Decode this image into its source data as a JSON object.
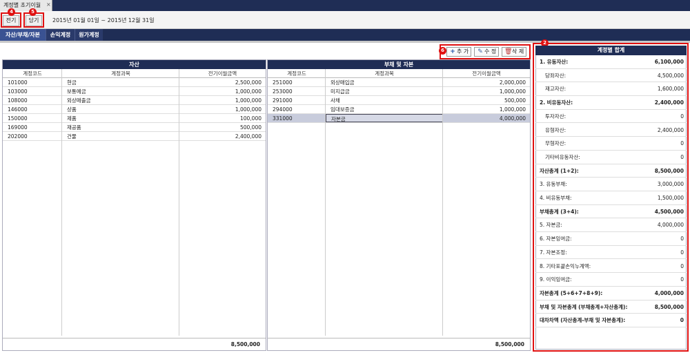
{
  "window_tab": {
    "title": "계정별 초기이월",
    "close": "×"
  },
  "toolbar": {
    "prev_label": "전기",
    "current_label": "당기",
    "period": "2015년 01월 01일 ~ 2015년 12월 31일",
    "badges": {
      "prev": "4",
      "current": "5",
      "actions": "6",
      "summary": "2"
    }
  },
  "subtabs": [
    "자산/부채/자본",
    "손익계정",
    "원가계정"
  ],
  "actions": {
    "add": "추 가",
    "edit": "수 정",
    "delete": "삭 제"
  },
  "assets": {
    "title": "자산",
    "headers": [
      "계정코드",
      "계정과목",
      "전기이월금액"
    ],
    "rows": [
      [
        "101000",
        "현금",
        "2,500,000"
      ],
      [
        "103000",
        "보통예금",
        "1,000,000"
      ],
      [
        "108000",
        "외상매출금",
        "1,000,000"
      ],
      [
        "146000",
        "상품",
        "1,000,000"
      ],
      [
        "150000",
        "제품",
        "100,000"
      ],
      [
        "169000",
        "재공품",
        "500,000"
      ],
      [
        "202000",
        "건물",
        "2,400,000"
      ]
    ],
    "total": "8,500,000"
  },
  "liabilities": {
    "title": "부채 및 자본",
    "headers": [
      "계정코드",
      "계정과목",
      "전기이월금액"
    ],
    "rows": [
      [
        "251000",
        "외상매입금",
        "2,000,000"
      ],
      [
        "253000",
        "미지급금",
        "1,000,000"
      ],
      [
        "291000",
        "사채",
        "500,000"
      ],
      [
        "294000",
        "임대보증금",
        "1,000,000"
      ],
      [
        "331000",
        "자본금",
        "4,000,000"
      ]
    ],
    "selected_row": 4,
    "total": "8,500,000"
  },
  "summary": {
    "title": "계정별 합계",
    "rows": [
      {
        "label": "1. 유동자산:",
        "value": "6,100,000",
        "bold": true,
        "indent": false
      },
      {
        "label": "당좌자산:",
        "value": "4,500,000",
        "bold": false,
        "indent": true
      },
      {
        "label": "재고자산:",
        "value": "1,600,000",
        "bold": false,
        "indent": true
      },
      {
        "label": "2. 비유동자산:",
        "value": "2,400,000",
        "bold": true,
        "indent": false
      },
      {
        "label": "투자자산:",
        "value": "0",
        "bold": false,
        "indent": true
      },
      {
        "label": "유형자산:",
        "value": "2,400,000",
        "bold": false,
        "indent": true
      },
      {
        "label": "무형자산:",
        "value": "0",
        "bold": false,
        "indent": true
      },
      {
        "label": "기타비유동자산:",
        "value": "0",
        "bold": false,
        "indent": true
      },
      {
        "label": "자산총계 (1+2):",
        "value": "8,500,000",
        "bold": true,
        "indent": false
      },
      {
        "label": "3. 유동부채:",
        "value": "3,000,000",
        "bold": false,
        "indent": false
      },
      {
        "label": "4. 비유동부채:",
        "value": "1,500,000",
        "bold": false,
        "indent": false
      },
      {
        "label": "부채총계 (3+4):",
        "value": "4,500,000",
        "bold": true,
        "indent": false
      },
      {
        "label": "5. 자본금:",
        "value": "4,000,000",
        "bold": false,
        "indent": false
      },
      {
        "label": "6. 자본잉여금:",
        "value": "0",
        "bold": false,
        "indent": false
      },
      {
        "label": "7. 자본조정:",
        "value": "0",
        "bold": false,
        "indent": false
      },
      {
        "label": "8. 기타포괄손익누계액:",
        "value": "0",
        "bold": false,
        "indent": false
      },
      {
        "label": "9. 이익잉여금:",
        "value": "0",
        "bold": false,
        "indent": false
      },
      {
        "label": "자본총계 (5+6+7+8+9):",
        "value": "4,000,000",
        "bold": true,
        "indent": false
      },
      {
        "label": "부채 및 자본총계 (부채총계+자산총계):",
        "value": "8,500,000",
        "bold": true,
        "indent": false
      },
      {
        "label": "대차차액 (자산총계-부채 및 자본총계):",
        "value": "0",
        "bold": true,
        "indent": false
      }
    ]
  }
}
